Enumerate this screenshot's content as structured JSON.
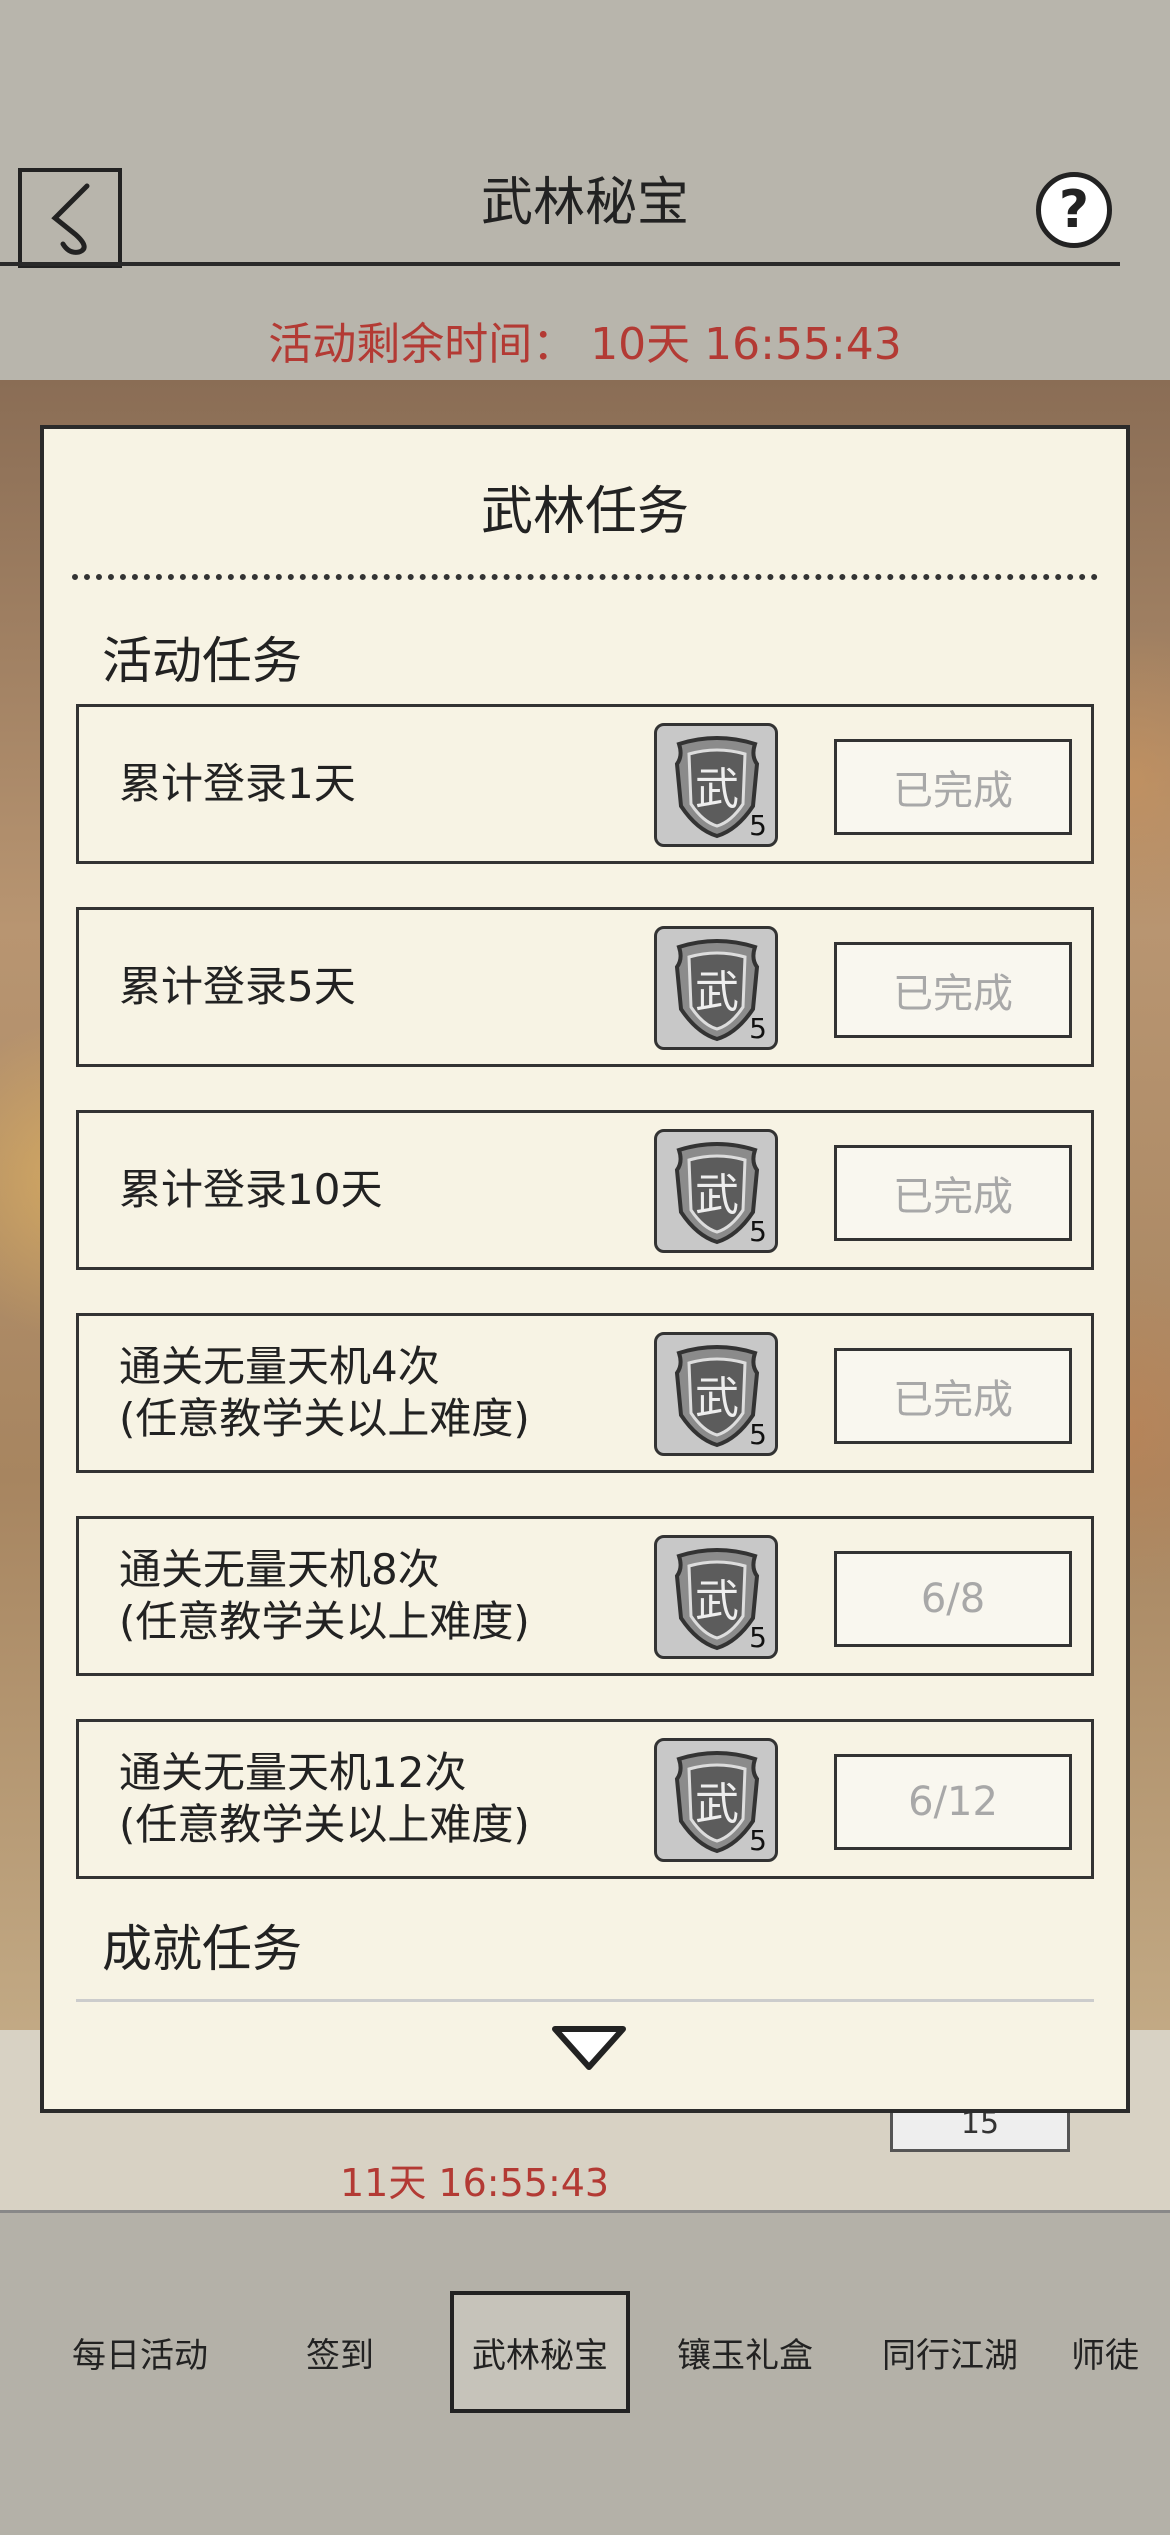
{
  "header": {
    "title": "武林秘宝",
    "help": "?",
    "timer_text": "活动剩余时间： 10天 16:55:43"
  },
  "panel": {
    "title": "武林任务",
    "section_activity": "活动任务",
    "section_achievement": "成就任务",
    "tasks": [
      {
        "line1": "累计登录1天",
        "line2": "",
        "reward_count": "5",
        "status": "已完成"
      },
      {
        "line1": "累计登录5天",
        "line2": "",
        "reward_count": "5",
        "status": "已完成"
      },
      {
        "line1": "累计登录10天",
        "line2": "",
        "reward_count": "5",
        "status": "已完成"
      },
      {
        "line1": "通关无量天机4次",
        "line2": "(任意教学关以上难度)",
        "reward_count": "5",
        "status": "已完成"
      },
      {
        "line1": "通关无量天机8次",
        "line2": "(任意教学关以上难度)",
        "reward_count": "5",
        "status": "6/8"
      },
      {
        "line1": "通关无量天机12次",
        "line2": "(任意教学关以上难度)",
        "reward_count": "5",
        "status": "6/12"
      }
    ],
    "reward_glyph": "武"
  },
  "background": {
    "timer_text": "11天 16:55:43",
    "count": "15"
  },
  "bottom_nav": {
    "tabs": [
      "每日活动",
      "签到",
      "武林秘宝",
      "镶玉礼盒",
      "同行江湖",
      "师徒"
    ],
    "active": "武林秘宝"
  },
  "colors": {
    "accent_red": "#b33a34",
    "panel_bg": "#f7f3e4",
    "page_bg": "#b4b1a8"
  }
}
